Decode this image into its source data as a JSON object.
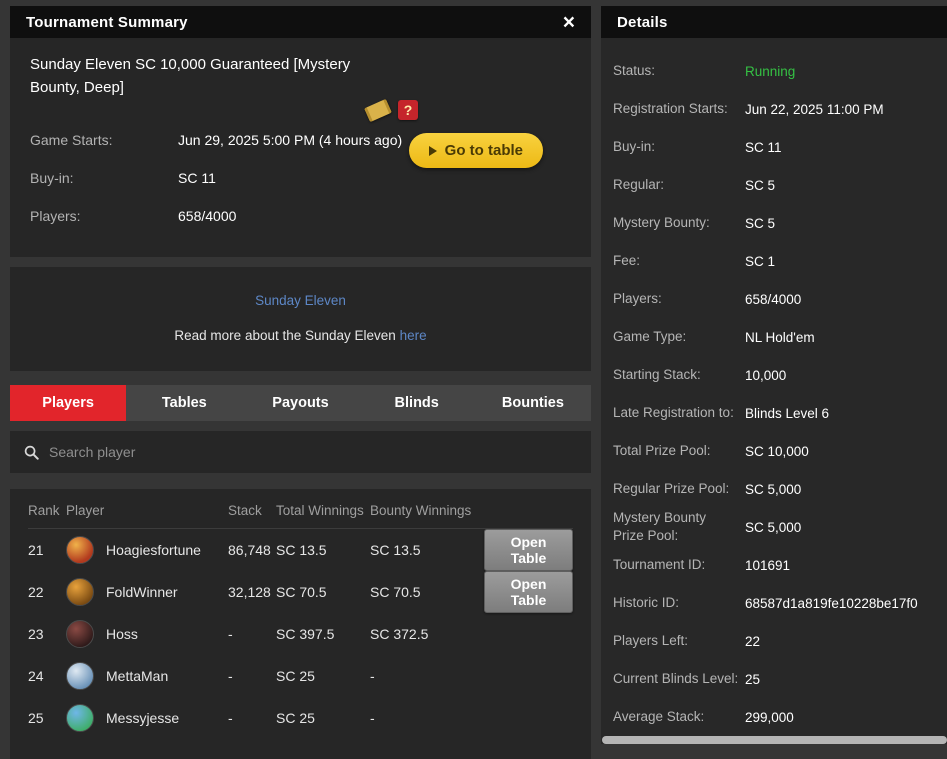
{
  "colors": {
    "accent_red": "#e2252b",
    "accent_yellow": "#f2c230",
    "status_green": "#35c144",
    "link_blue": "#5d87c6"
  },
  "left_panel": {
    "header": {
      "title": "Tournament Summary",
      "close_icon": "×"
    },
    "summary": {
      "title": "Sunday Eleven SC 10,000 Guaranteed [Mystery Bounty, Deep]",
      "mystery_icon_glyph": "?",
      "fields": [
        {
          "label": "Game Starts:",
          "value": "Jun 29, 2025 5:00 PM (4 hours ago)"
        },
        {
          "label": "Buy-in:",
          "value": "SC 11"
        },
        {
          "label": "Players:",
          "value": "658/4000"
        }
      ],
      "go_to_table_label": "Go to table"
    },
    "promo": {
      "series_link": "Sunday Eleven",
      "read_more_text": "Read more about the Sunday Eleven ",
      "read_more_link": "here"
    },
    "tabs": [
      "Players",
      "Tables",
      "Payouts",
      "Blinds",
      "Bounties"
    ],
    "active_tab": "Players",
    "search_placeholder": "Search player",
    "players_table": {
      "headers": {
        "rank": "Rank",
        "player": "Player",
        "stack": "Stack",
        "total": "Total Winnings",
        "bounty": "Bounty Winnings"
      },
      "open_table_label": "Open Table",
      "rows": [
        {
          "rank": "21",
          "player": "Hoagiesfortune",
          "stack": "86,748",
          "total_winnings": "SC 13.5",
          "bounty_winnings": "SC 13.5"
        },
        {
          "rank": "22",
          "player": "FoldWinner",
          "stack": "32,128",
          "total_winnings": "SC 70.5",
          "bounty_winnings": "SC 70.5"
        },
        {
          "rank": "23",
          "player": "Hoss",
          "stack": "-",
          "total_winnings": "SC 397.5",
          "bounty_winnings": "SC 372.5"
        },
        {
          "rank": "24",
          "player": "MettaMan",
          "stack": "-",
          "total_winnings": "SC 25",
          "bounty_winnings": "-"
        },
        {
          "rank": "25",
          "player": "Messyjesse",
          "stack": "-",
          "total_winnings": "SC 25",
          "bounty_winnings": "-"
        }
      ]
    }
  },
  "right_panel": {
    "title": "Details",
    "rows": [
      {
        "label": "Status:",
        "value": "Running"
      },
      {
        "label": "Registration Starts:",
        "value": "Jun 22, 2025 11:00 PM"
      },
      {
        "label": "Buy-in:",
        "value": "SC 11"
      },
      {
        "label": "Regular:",
        "value": "SC 5"
      },
      {
        "label": "Mystery Bounty:",
        "value": "SC 5"
      },
      {
        "label": "Fee:",
        "value": "SC 1"
      },
      {
        "label": "Players:",
        "value": "658/4000"
      },
      {
        "label": "Game Type:",
        "value": "NL Hold'em"
      },
      {
        "label": "Starting Stack:",
        "value": "10,000"
      },
      {
        "label": "Late Registration to:",
        "value": "Blinds Level 6"
      },
      {
        "label": "Total Prize Pool:",
        "value": "SC 10,000"
      },
      {
        "label": "Regular Prize Pool:",
        "value": "SC 5,000"
      },
      {
        "label": "Mystery Bounty Prize Pool:",
        "value": "SC 5,000"
      },
      {
        "label": "Tournament ID:",
        "value": "101691"
      },
      {
        "label": "Historic ID:",
        "value": "68587d1a819fe10228be17f0"
      },
      {
        "label": "Players Left:",
        "value": "22"
      },
      {
        "label": "Current Blinds Level:",
        "value": "25"
      },
      {
        "label": "Average Stack:",
        "value": "299,000"
      }
    ]
  }
}
